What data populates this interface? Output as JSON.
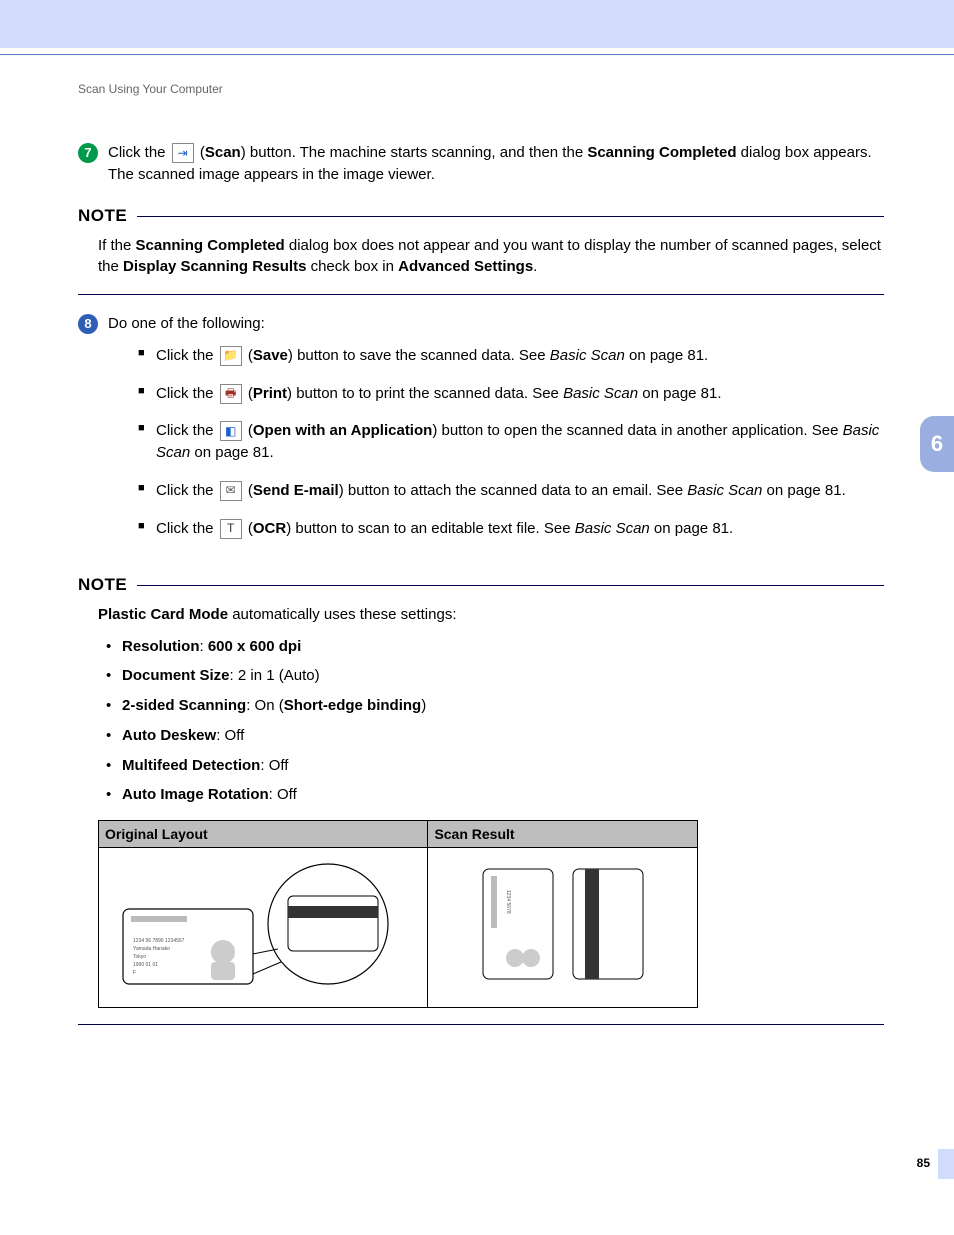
{
  "header": {
    "section_title": "Scan Using Your Computer"
  },
  "side_tab": {
    "chapter_number": "6"
  },
  "page_number": "85",
  "step7": {
    "number": "7",
    "text_before_icon": "Click the ",
    "scan_label": "Scan",
    "text_after": ") button. The machine starts scanning, and then the ",
    "scanning_completed": "Scanning Completed",
    "text_end": " dialog box appears. The scanned image appears in the image viewer.",
    "icon_name": "scan-icon"
  },
  "note1": {
    "label": "NOTE",
    "text_a": "If the ",
    "bold_a": "Scanning Completed",
    "text_b": " dialog box does not appear and you want to display the number of scanned pages, select the ",
    "bold_b": "Display Scanning Results",
    "text_c": " check box in ",
    "bold_c": "Advanced Settings",
    "text_d": "."
  },
  "step8": {
    "number": "8",
    "intro": "Do one of the following:",
    "items": [
      {
        "prefix": "Click the ",
        "button_label": "Save",
        "after": ") button to save the scanned data. See ",
        "ref": "Basic Scan",
        "tail": " on page 81.",
        "icon": "save-icon",
        "icon_class": "icon-save",
        "glyph": "📁"
      },
      {
        "prefix": "Click the ",
        "button_label": "Print",
        "after": ") button to to print the scanned data. See ",
        "ref": "Basic Scan",
        "tail": " on page 81.",
        "icon": "print-icon",
        "icon_class": "icon-print",
        "glyph": "🖶"
      },
      {
        "prefix": "Click the ",
        "button_label": "Open with an Application",
        "after": ") button to open the scanned data in another application. See ",
        "ref": "Basic Scan",
        "tail": " on page 81.",
        "icon": "open-app-icon",
        "icon_class": "icon-open",
        "glyph": "◧"
      },
      {
        "prefix": "Click the ",
        "button_label": "Send E-mail",
        "after": ") button to attach the scanned data to an email. See ",
        "ref": "Basic Scan",
        "tail": " on page 81.",
        "icon": "send-email-icon",
        "icon_class": "icon-mail",
        "glyph": "✉"
      },
      {
        "prefix": "Click the ",
        "button_label": "OCR",
        "after": ") button to scan to an editable text file. See ",
        "ref": "Basic Scan",
        "tail": " on page 81.",
        "icon": "ocr-icon",
        "icon_class": "icon-ocr",
        "glyph": "T"
      }
    ]
  },
  "note2": {
    "label": "NOTE",
    "intro_bold": "Plastic Card Mode",
    "intro_rest": " automatically uses these settings:",
    "settings": [
      {
        "label": "Resolution",
        "sep": ": ",
        "value_bold": "600 x 600 dpi",
        "value_plain": ""
      },
      {
        "label": "Document Size",
        "sep": ": ",
        "value_bold": "",
        "value_plain": "2 in 1 (Auto)"
      },
      {
        "label": "2-sided Scanning",
        "sep": ": On (",
        "value_bold": "Short-edge binding",
        "value_plain": ")"
      },
      {
        "label": "Auto Deskew",
        "sep": ": ",
        "value_bold": "",
        "value_plain": "Off"
      },
      {
        "label": "Multifeed Detection",
        "sep": ": ",
        "value_bold": "",
        "value_plain": "Off"
      },
      {
        "label": "Auto Image Rotation",
        "sep": ": ",
        "value_bold": "",
        "value_plain": "Off"
      }
    ]
  },
  "table": {
    "col1": "Original Layout",
    "col2": "Scan Result"
  }
}
